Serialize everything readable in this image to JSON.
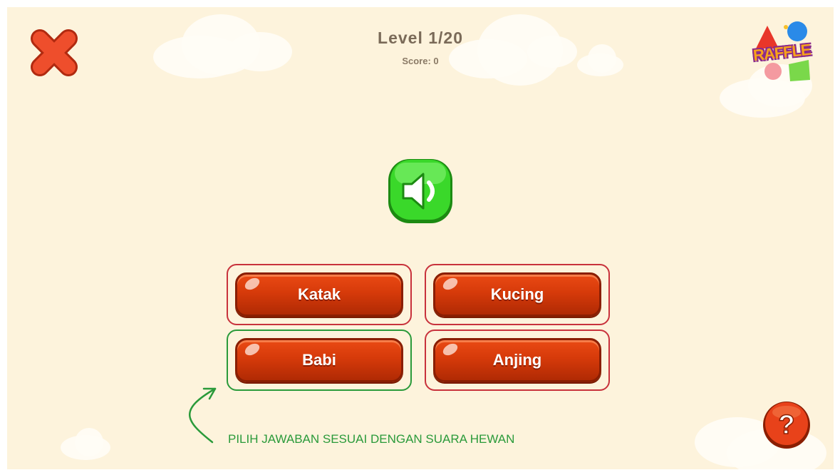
{
  "header": {
    "level": "Level 1/20",
    "score": "Score: 0"
  },
  "logo": {
    "text": "RAFFLE"
  },
  "answers": [
    {
      "label": "Katak",
      "highlight": "#c8323c"
    },
    {
      "label": "Kucing",
      "highlight": "#c8323c"
    },
    {
      "label": "Babi",
      "highlight": "#2a9a3a"
    },
    {
      "label": "Anjing",
      "highlight": "#c8323c"
    }
  ],
  "instruction": "PILIH JAWABAN SESUAI DENGAN SUARA HEWAN",
  "icons": {
    "close": "close-icon",
    "sound": "speaker-icon",
    "help": "question-icon"
  },
  "colors": {
    "background": "#fdf3dc",
    "answer_button": "#d63a0a",
    "sound_button": "#3ad82a",
    "close": "#e84a2a",
    "annotation_correct": "#2a9a3a",
    "annotation_wrong": "#c8323c"
  }
}
